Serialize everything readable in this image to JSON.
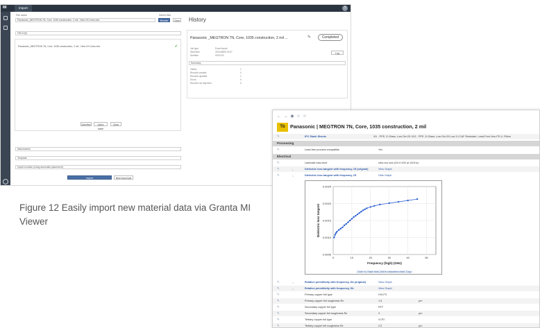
{
  "import_window": {
    "tab_label": "Import",
    "logo_text": "MI",
    "file_label": "File name",
    "file_value": "Panasonic_MEGTRON 7N, Core, 1035 construction, 2 mil - New Of Cores.xlsx",
    "select_label": "Select files",
    "browse_label": "Browse",
    "clear_label": "Clear",
    "section_label": "FIELD(S)",
    "list_item": "Panasonic_MEGTRON 7N, Core, 1035 construction, 2 mil - New Of Cores.xlsx",
    "list_buttons": [
      "Add files",
      "Add a folder",
      "Clear"
    ],
    "options": [
      "Attachments",
      "Template"
    ],
    "options_note": "Import location (using automatic placement)",
    "import_label": "Import",
    "new_import_label": "New import job",
    "history": {
      "title": "History",
      "name": "Panasonic _MEGTRON 7N, Core, 1035 construction, 2 mil ...",
      "status": "Completed",
      "fields": [
        {
          "k": "Job type",
          "v": "Excel import"
        },
        {
          "k": "Start time",
          "v": "2021/08/05 15:47"
        },
        {
          "k": "Duration",
          "v": "00:00:03"
        }
      ],
      "log_label": "Log",
      "summary_label": "Summary",
      "summary": [
        {
          "k": "Tables",
          "v": "1"
        },
        {
          "k": "Records created",
          "v": "0"
        },
        {
          "k": "Records updated",
          "v": "1"
        },
        {
          "k": "Errors",
          "v": "0"
        },
        {
          "k": "Records not imported",
          "v": "0"
        }
      ]
    }
  },
  "caption": "Figure 12 Easily import new material data via Granta MI Viewer",
  "viewer": {
    "nav_icons": "← → ◉ ☆ ☆",
    "badge": "Tb",
    "title": "Panasonic | MEGTRON 7N, Core, 1035 construction, 2 mil",
    "ipc_label": "IPC Slash Sheets",
    "ipc_value": "/91 - PPE, E-Glass, Low Dk<25 /102 - PPE, E-Glass, Low Dk<25 Low 3-f CAF Resistant, Lead-Free Non-FR-4, Fillers",
    "sections": [
      "Processing",
      "Electrical"
    ],
    "processing_row": {
      "attr": "Lead-free process compatible",
      "val": "Yes"
    },
    "laminate_row": {
      "attr": "Laminate loss level",
      "val": "ultra low loss (Df<0.005 at 10GHz)"
    },
    "graph_rows": [
      {
        "attr": "Dielectric loss tangent with frequency, Df (original)",
        "val": "View Graph"
      },
      {
        "attr": "Dielectric loss tangent with frequency, Df",
        "val": "Hide Graph"
      }
    ],
    "chart_footer": "Zoom in | Graph tools | Add to comparison chart | Copy",
    "after_rows": [
      {
        "attr": "Relative permittivity with frequency, Dk (original)",
        "val": "View Graph",
        "link": true,
        "graph": true
      },
      {
        "attr": "Relative permittivity with frequency, Dk",
        "val": "View Graph",
        "link": true,
        "graph": true
      },
      {
        "attr": "Primary copper foil type",
        "val": "HVLP3",
        "unit": "",
        "link": false,
        "graph": false
      },
      {
        "attr": "Primary copper foil roughness Rz",
        "val": "1.5",
        "unit": "µm",
        "link": false,
        "graph": false
      },
      {
        "attr": "Secondary copper foil type",
        "val": "RTF",
        "unit": "",
        "link": false,
        "graph": false
      },
      {
        "attr": "Secondary copper foil roughness Rz",
        "val": "3",
        "unit": "µm",
        "link": false,
        "graph": false
      },
      {
        "attr": "Tertiary copper foil type",
        "val": "VLP2",
        "unit": "",
        "link": false,
        "graph": false
      },
      {
        "attr": "Tertiary copper foil roughness Rz",
        "val": "2.5",
        "unit": "µm",
        "link": false,
        "graph": false
      }
    ]
  },
  "chart_data": {
    "type": "line",
    "xlabel": "Frequency (high) (GHz)",
    "ylabel": "Dielectric loss tangent",
    "xlim": [
      0,
      55
    ],
    "ylim": [
      0.0005,
      0.0025
    ],
    "xticks": [
      0,
      10,
      20,
      30,
      40,
      50
    ],
    "yticks": [
      0.0005,
      0.001,
      0.0015,
      0.002,
      0.0025
    ],
    "xtick_labels": [
      "0",
      "10",
      "20",
      "30",
      "40",
      "50"
    ],
    "ytick_labels": [
      "0.0005",
      "0.0010",
      "0.0015",
      "0.0020",
      "0.0025"
    ],
    "grid": true,
    "color": "#2a5fd0",
    "x": [
      0.5,
      1,
      1.5,
      2,
      3,
      4,
      5,
      6,
      7,
      8,
      9,
      10,
      11,
      12,
      13,
      14,
      15,
      16,
      17,
      18,
      20,
      22,
      25,
      30,
      35,
      40,
      45
    ],
    "values": [
      0.001,
      0.00108,
      0.00113,
      0.00117,
      0.00122,
      0.00126,
      0.0013,
      0.00136,
      0.0014,
      0.00145,
      0.0015,
      0.00155,
      0.0016,
      0.00164,
      0.00168,
      0.00172,
      0.00176,
      0.0018,
      0.00183,
      0.00186,
      0.0019,
      0.00193,
      0.00197,
      0.00201,
      0.00205,
      0.00209,
      0.00213
    ]
  }
}
